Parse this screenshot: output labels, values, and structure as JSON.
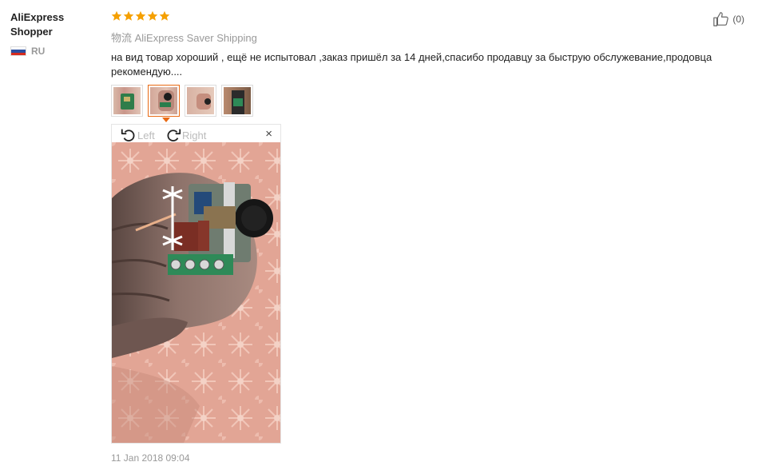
{
  "user": {
    "name": "AliExpress Shopper",
    "country": "RU"
  },
  "review": {
    "rating": 5,
    "rating_max": 5,
    "shipping": "物流 AliExpress Saver Shipping",
    "text": "на вид товар хороший , ещё не испытовал ,заказ пришёл за 14 дней,спасибо продавцу за быструю обслужевание,продовца рекомендую....",
    "date": "11 Jan 2018 09:04"
  },
  "helpful": {
    "count": "(0)"
  },
  "viewer": {
    "rotate_left": "Left",
    "rotate_right": "Right",
    "close": "×"
  },
  "thumbnails": [
    {
      "name": "thumbnail-1"
    },
    {
      "name": "thumbnail-2",
      "active": true
    },
    {
      "name": "thumbnail-3"
    },
    {
      "name": "thumbnail-4"
    }
  ],
  "colors": {
    "star": "#f5a000",
    "accent": "#e96a14"
  }
}
